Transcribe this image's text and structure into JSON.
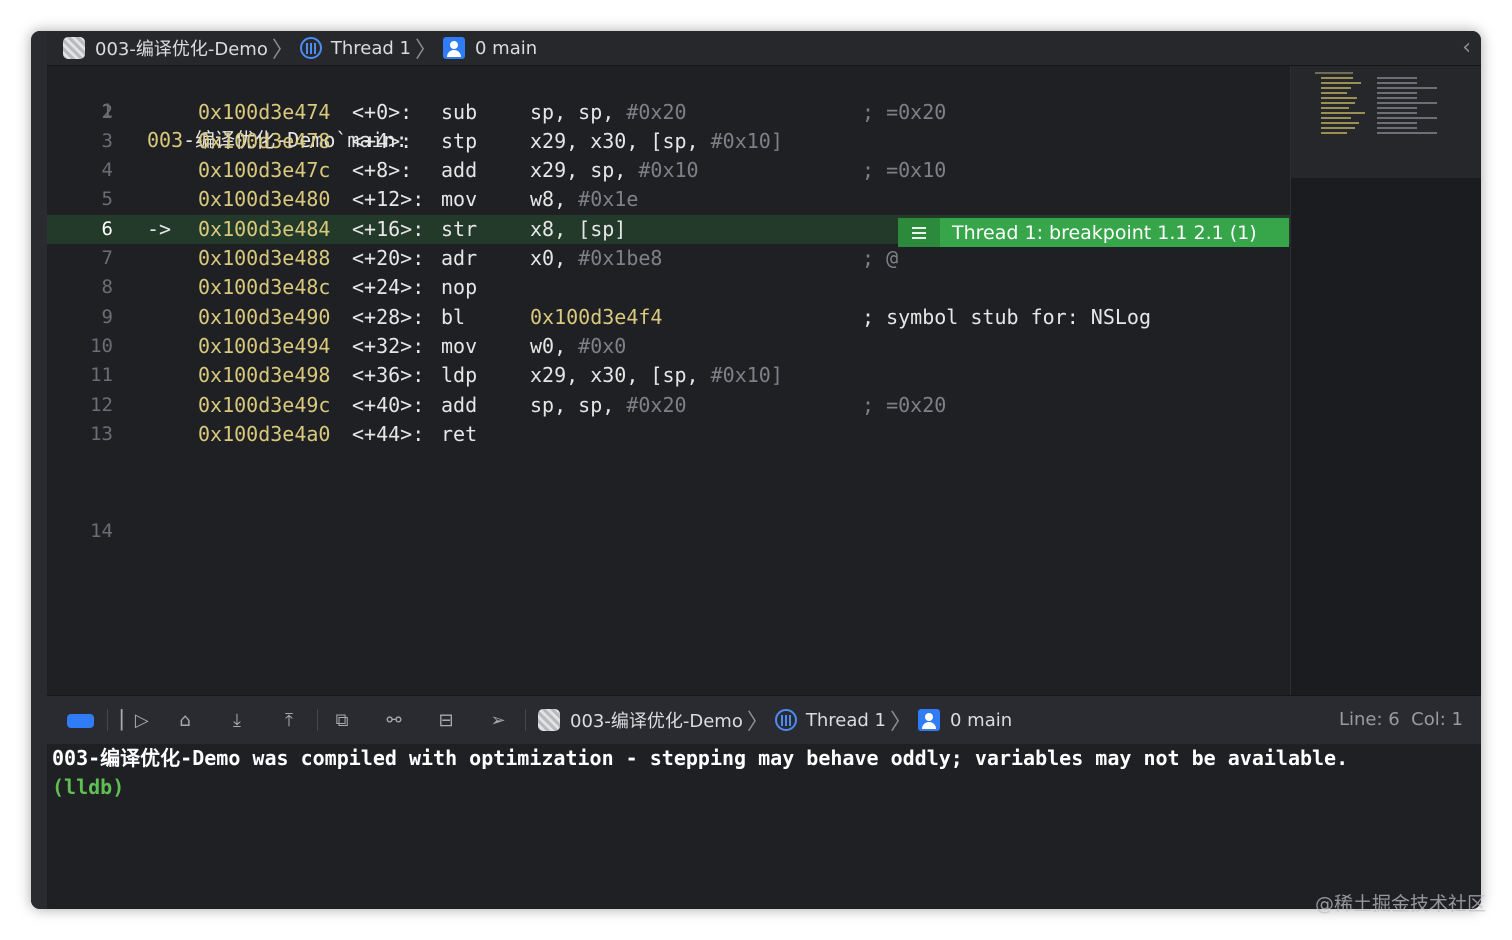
{
  "jump_bar": {
    "project": "003-编译优化-Demo",
    "thread": "Thread 1",
    "frame": "0 main"
  },
  "disassembly": {
    "title_prefix": "003",
    "title_rest": "-编译优化-Demo`main:",
    "lines": [
      {
        "num": "2",
        "arrow": "",
        "addr": "0x100d3e474",
        "offset": "<+0>:",
        "op": "sub",
        "r1": "sp, sp, ",
        "imm": "#0x20",
        "comment": "; =0x20"
      },
      {
        "num": "3",
        "arrow": "",
        "addr": "0x100d3e478",
        "offset": "<+4>:",
        "op": "stp",
        "r1": "x29, x30, [sp, ",
        "imm": "#0x10]",
        "comment": ""
      },
      {
        "num": "4",
        "arrow": "",
        "addr": "0x100d3e47c",
        "offset": "<+8>:",
        "op": "add",
        "r1": "x29, sp, ",
        "imm": "#0x10",
        "comment": "; =0x10"
      },
      {
        "num": "5",
        "arrow": "",
        "addr": "0x100d3e480",
        "offset": "<+12>:",
        "op": "mov",
        "r1": "w8, ",
        "imm": "#0x1e",
        "comment": ""
      },
      {
        "num": "6",
        "arrow": "->",
        "addr": "0x100d3e484",
        "offset": "<+16>:",
        "op": "str",
        "r1": "x8, [sp]",
        "imm": "",
        "comment": ""
      },
      {
        "num": "7",
        "arrow": "",
        "addr": "0x100d3e488",
        "offset": "<+20>:",
        "op": "adr",
        "r1": "x0, ",
        "imm": "#0x1be8",
        "comment": "; @"
      },
      {
        "num": "8",
        "arrow": "",
        "addr": "0x100d3e48c",
        "offset": "<+24>:",
        "op": "nop",
        "r1": "",
        "imm": "",
        "comment": ""
      },
      {
        "num": "9",
        "arrow": "",
        "addr": "0x100d3e490",
        "offset": "<+28>:",
        "op": "bl",
        "target": "0x100d3e4f4",
        "comment": "; symbol stub for: NSLog"
      },
      {
        "num": "10",
        "arrow": "",
        "addr": "0x100d3e494",
        "offset": "<+32>:",
        "op": "mov",
        "r1": "w0, ",
        "imm": "#0x0",
        "comment": ""
      },
      {
        "num": "11",
        "arrow": "",
        "addr": "0x100d3e498",
        "offset": "<+36>:",
        "op": "ldp",
        "r1": "x29, x30, [sp, ",
        "imm": "#0x10]",
        "comment": ""
      },
      {
        "num": "12",
        "arrow": "",
        "addr": "0x100d3e49c",
        "offset": "<+40>:",
        "op": "add",
        "r1": "sp, sp, ",
        "imm": "#0x20",
        "comment": "; =0x20"
      },
      {
        "num": "13",
        "arrow": "",
        "addr": "0x100d3e4a0",
        "offset": "<+44>:",
        "op": "ret",
        "r1": "",
        "imm": "",
        "comment": ""
      }
    ],
    "line_numbers": [
      "1",
      "14"
    ],
    "breakpoint_label": "Thread 1: breakpoint 1.1 2.1 (1)"
  },
  "debug_bar": {
    "project": "003-编译优化-Demo",
    "thread": "Thread 1",
    "frame": "0 main",
    "line_col": "Line: 6  Col: 1",
    "icons": [
      "breakpoints-toggle-icon",
      "continue-icon",
      "step-over-icon",
      "step-into-icon",
      "step-out-icon",
      "view-hierarchy-icon",
      "memory-graph-icon",
      "environment-overrides-icon",
      "simulate-location-icon"
    ]
  },
  "console": {
    "message": "003-编译优化-Demo was compiled with optimization - stepping may behave oddly; variables may not be available.",
    "prompt": "(lldb)"
  },
  "watermark": "@稀土掘金技术社区",
  "colors": {
    "background": "#1f2024",
    "address": "#d9c97c",
    "breakpoint": "#37a64a",
    "current_line": "#23392a",
    "prompt": "#5fbf53"
  }
}
